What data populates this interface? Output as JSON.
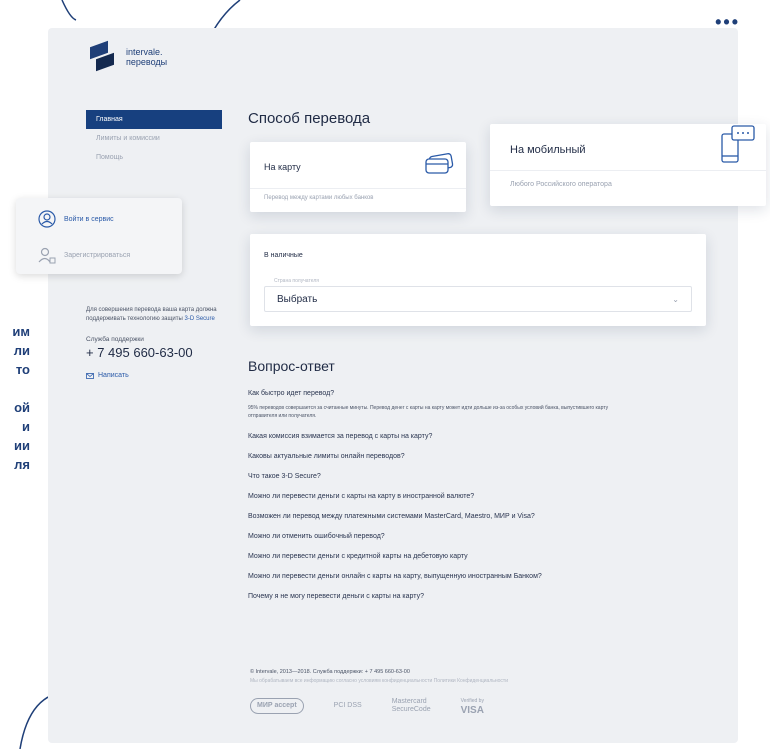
{
  "menu": {
    "more_label": "•••"
  },
  "brand": {
    "line1": "intervale.",
    "line2": "переводы"
  },
  "nav": {
    "items": [
      {
        "label": "Главная",
        "active": true
      },
      {
        "label": "Лимиты и комиссии",
        "active": false
      },
      {
        "label": "Помощь",
        "active": false
      }
    ]
  },
  "login": {
    "login_label": "Войти в сервис",
    "register_label": "Зарегистрироваться"
  },
  "side_text": [
    "им",
    "ли",
    "то",
    "",
    "ой",
    "и",
    "ии",
    "ля"
  ],
  "info": {
    "note_prefix": "Для совершения перевода ваша карта должна поддерживать технологию защиты ",
    "note_link": "3-D Secure",
    "support_label": "Служба поддержки",
    "phone": "+ 7 495 660-63-00",
    "write_label": "Написать"
  },
  "transfer": {
    "title": "Способ перевода",
    "to_card": {
      "title": "На карту",
      "subtitle": "Перевод между картами любых банков"
    },
    "to_mobile": {
      "title": "На мобильный",
      "subtitle": "Любого Российского оператора"
    },
    "cash": {
      "title": "В наличные",
      "field_label": "Страна получателя",
      "select_value": "Выбрать",
      "chevron": "⌄"
    }
  },
  "faq": {
    "title": "Вопрос-ответ",
    "first_question": "Как быстро идет перевод?",
    "first_answer": "95% переводов совершается за считанные минуты. Перевод денег с карты на карту может идти дольше из-за особых условий банка, выпустившего карту отправителя или получателя.",
    "questions": [
      "Какая комиссия взимается за перевод с карты на карту?",
      "Каковы актуальные лимиты онлайн переводов?",
      "Что такое 3-D Secure?",
      "Можно ли перевести деньги с карты на карту в иностранной валюте?",
      "Возможен ли перевод между платежными системами MasterCard, Maestro, МИР и Visa?",
      "Можно ли отменить ошибочный перевод?",
      "Можно ли перевести деньги с кредитной карты на дебетовую карту",
      "Можно ли перевести деньги онлайн с карты на карту, выпущенную иностранным Банком?",
      "Почему я не могу перевести деньги с карты на карту?"
    ]
  },
  "footer": {
    "copyright": "© Intervale, 2013—2018. Служба поддержки: + 7 495 660-63-00",
    "disclaimer": "Мы обрабатываем все информацию согласно условиям конфиденциальности Политики Конфиденциальности",
    "logos": {
      "mir": "МИР",
      "mir_accept": "accept",
      "pci": "PCI DSS",
      "mc_line1": "Mastercard",
      "mc_line2": "SecureCode",
      "visa_small": "Verified by",
      "visa": "VISA"
    }
  },
  "colors": {
    "primary": "#17407f",
    "link": "#2a5aa8",
    "background": "#eef0f3",
    "muted": "#9aa2b1"
  }
}
